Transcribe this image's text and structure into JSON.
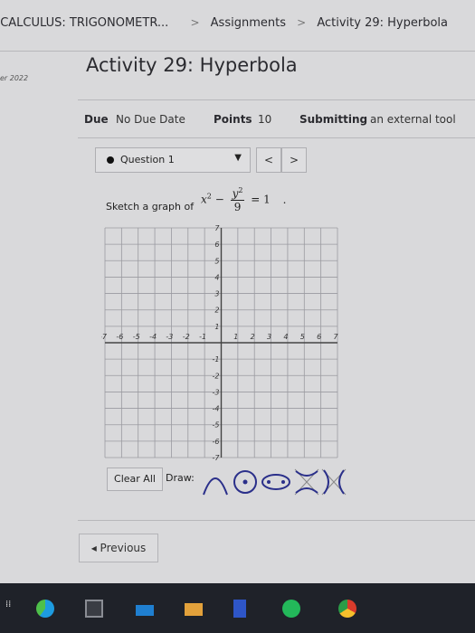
{
  "breadcrumb": {
    "course": "ECALCULUS: TRIGONOMETR...",
    "assignments": "Assignments",
    "current": "Activity 29: Hyperbola",
    "sep": ">"
  },
  "sidebar": {
    "term": "er 2022"
  },
  "page": {
    "title": "Activity 29: Hyperbola"
  },
  "meta": {
    "due_label": "Due",
    "due_value": "No Due Date",
    "points_label": "Points",
    "points_value": "10",
    "submitting_label": "Submitting",
    "submitting_value": "an external tool"
  },
  "question": {
    "selector_label": "Question 1",
    "prev_icon": "<",
    "next_icon": ">",
    "prompt": "Sketch a graph of",
    "equation": {
      "x_term": "x",
      "x_exp": "2",
      "minus": "−",
      "num_var": "y",
      "num_exp": "2",
      "den": "9",
      "equals": "= 1",
      "period": "."
    }
  },
  "graph": {
    "x_min": -7,
    "x_max": 7,
    "y_min": -7,
    "y_max": 7,
    "x_tick_labels": [
      "-7",
      "-6",
      "-5",
      "-4",
      "-3",
      "-2",
      "-1",
      "1",
      "2",
      "3",
      "4",
      "5",
      "6",
      "7"
    ],
    "y_tick_labels": [
      "7",
      "6",
      "5",
      "4",
      "3",
      "2",
      "1",
      "-1",
      "-2",
      "-3",
      "-4",
      "-5",
      "-6",
      "-7"
    ]
  },
  "tools": {
    "clear_label": "Clear All",
    "draw_label": "Draw:",
    "icons": [
      "parabola-tool-icon",
      "circle-tool-icon",
      "ellipse-tool-icon",
      "hyperbola-vertical-tool-icon",
      "hyperbola-horizontal-tool-icon"
    ],
    "accent": "#2a2f8a"
  },
  "footer": {
    "previous_label": "◂ Previous"
  },
  "taskbar": {
    "icons": [
      "windows-icon",
      "edge-icon",
      "calculator-icon",
      "files-icon",
      "mail-icon",
      "word-icon",
      "spotify-icon",
      "chrome-icon"
    ]
  }
}
